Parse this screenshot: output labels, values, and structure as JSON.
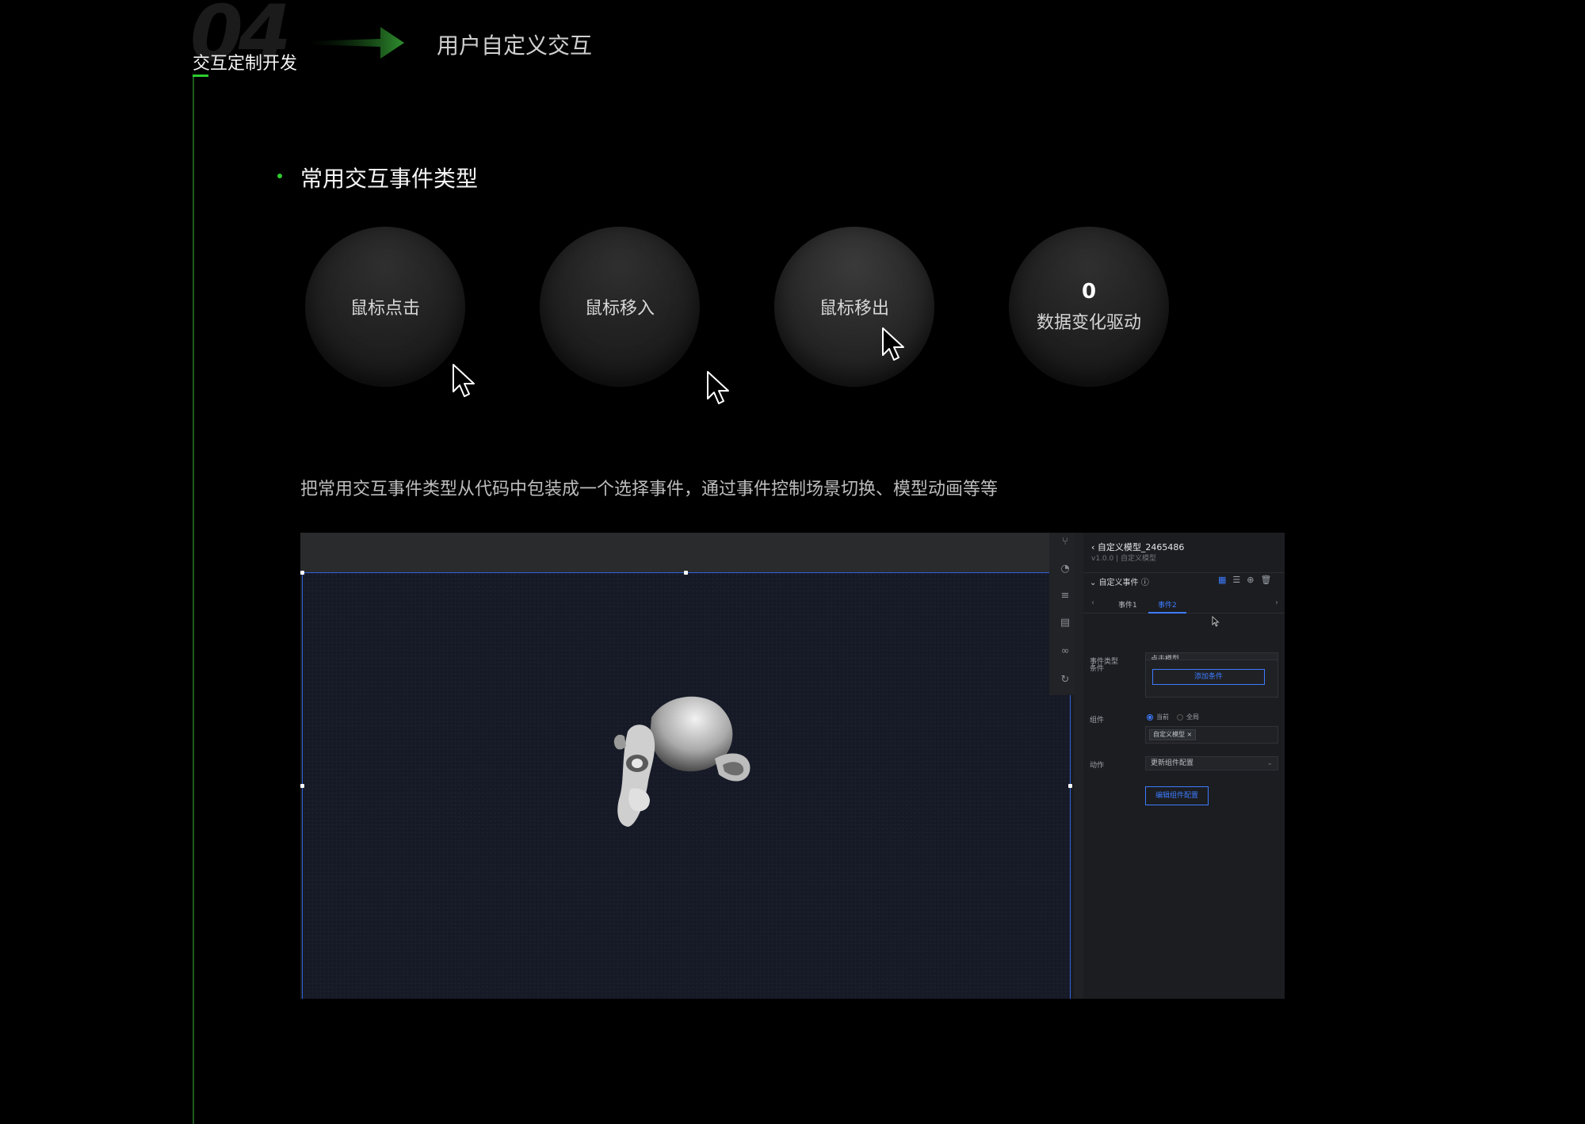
{
  "header": {
    "section_number": "04",
    "section_label": "交互定制开发",
    "sub_title": "用户自定义交互"
  },
  "main": {
    "heading": "常用交互事件类型",
    "circles": [
      {
        "label": "鼠标点击"
      },
      {
        "label": "鼠标移入"
      },
      {
        "label": "鼠标移出"
      },
      {
        "label": "数据变化驱动",
        "count": "0"
      }
    ],
    "description": "把常用交互事件类型从代码中包装成一个选择事件，通过事件控制场景切换、模型动画等等"
  },
  "editor": {
    "panel": {
      "title": "自定义模型_2465486",
      "subtitle": "v1.0.0 | 自定义模型",
      "section_label": "自定义事件",
      "tabs": [
        "事件1",
        "事件2"
      ],
      "active_tab": "事件2",
      "fields": {
        "event_type_label": "事件类型",
        "event_type_value": "点击模型",
        "condition_label": "条件",
        "add_condition_button": "添加条件",
        "component_label": "组件",
        "radio_current": "当前",
        "radio_all": "全局",
        "component_tag": "自定义模型 ×",
        "action_label": "动作",
        "action_value": "更新组件配置",
        "edit_config_button": "编辑组件配置"
      }
    }
  },
  "colors": {
    "accent_green": "#2ecc2e",
    "accent_blue": "#3d7bff",
    "background": "#000000"
  }
}
